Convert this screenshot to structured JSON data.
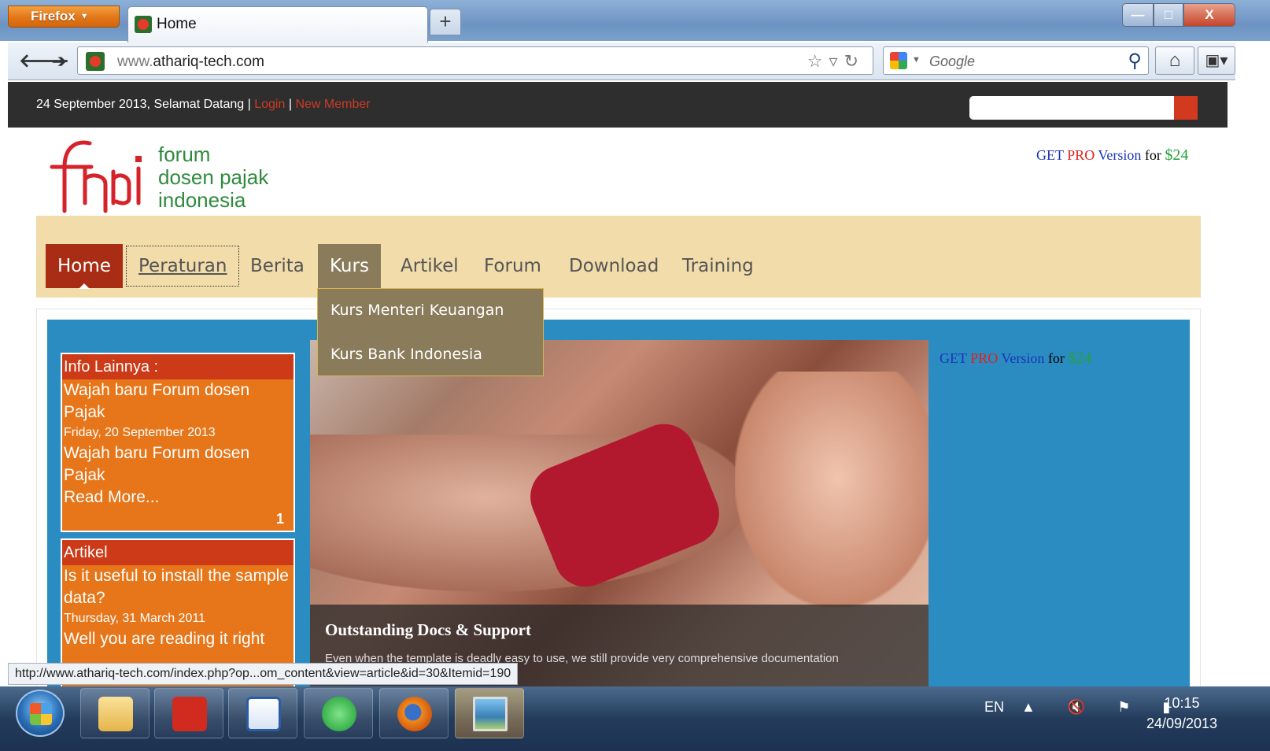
{
  "browser": {
    "app_menu": "Firefox",
    "tab_title": "Home",
    "new_tab": "+",
    "win_min": "—",
    "win_max": "□",
    "win_close": "X",
    "url_prefix": "www.",
    "url_domain": "athariq-tech.com",
    "search_engine": "Google",
    "status_url": "http://www.athariq-tech.com/index.php?op...om_content&view=article&id=30&Itemid=190"
  },
  "site": {
    "greeting": "24 September 2013, Selamat Datang",
    "sep": "|",
    "login": "Login",
    "new_member": "New Member",
    "logo_line1": "forum",
    "logo_line2": "dosen pajak",
    "logo_line3": "indonesia",
    "promo": {
      "get": "GET",
      "pro": "PRO",
      "version": "Version",
      "for": "for",
      "price": "$24"
    },
    "menu": [
      "Home",
      "Peraturan",
      "Berita",
      "Kurs",
      "Artikel",
      "Forum",
      "Download",
      "Training"
    ],
    "kurs_submenu": [
      "Kurs Menteri Keuangan",
      "Kurs Bank Indonesia"
    ],
    "info_box": {
      "title": "Info Lainnya :",
      "item_title": "Wajah baru Forum dosen Pajak",
      "item_date": "Friday, 20 September 2013",
      "item_intro": "Wajah baru Forum dosen Pajak",
      "read_more": "Read More...",
      "count": "1"
    },
    "artikel_box": {
      "title": "Artikel",
      "item_title_1": "Is it useful to install the sample",
      "item_title_2": "data?",
      "item_date": "Thursday, 31 March 2011",
      "item_intro": "Well you are reading it right"
    },
    "slide": {
      "title": "Outstanding Docs & Support",
      "text": "Even when the template is deadly easy to use, we still provide very comprehensive documentation"
    }
  },
  "taskbar": {
    "language": "EN",
    "tray_icons": "▲ 🔇 ⚑ ▮",
    "time": "10:15",
    "date": "24/09/2013"
  },
  "colors": {
    "accent_red": "#a82d14",
    "menu_bg": "#f1dcaa",
    "content_blue": "#2b8cc2",
    "box_orange": "#e67619",
    "logo_green": "#2e8b3d"
  }
}
